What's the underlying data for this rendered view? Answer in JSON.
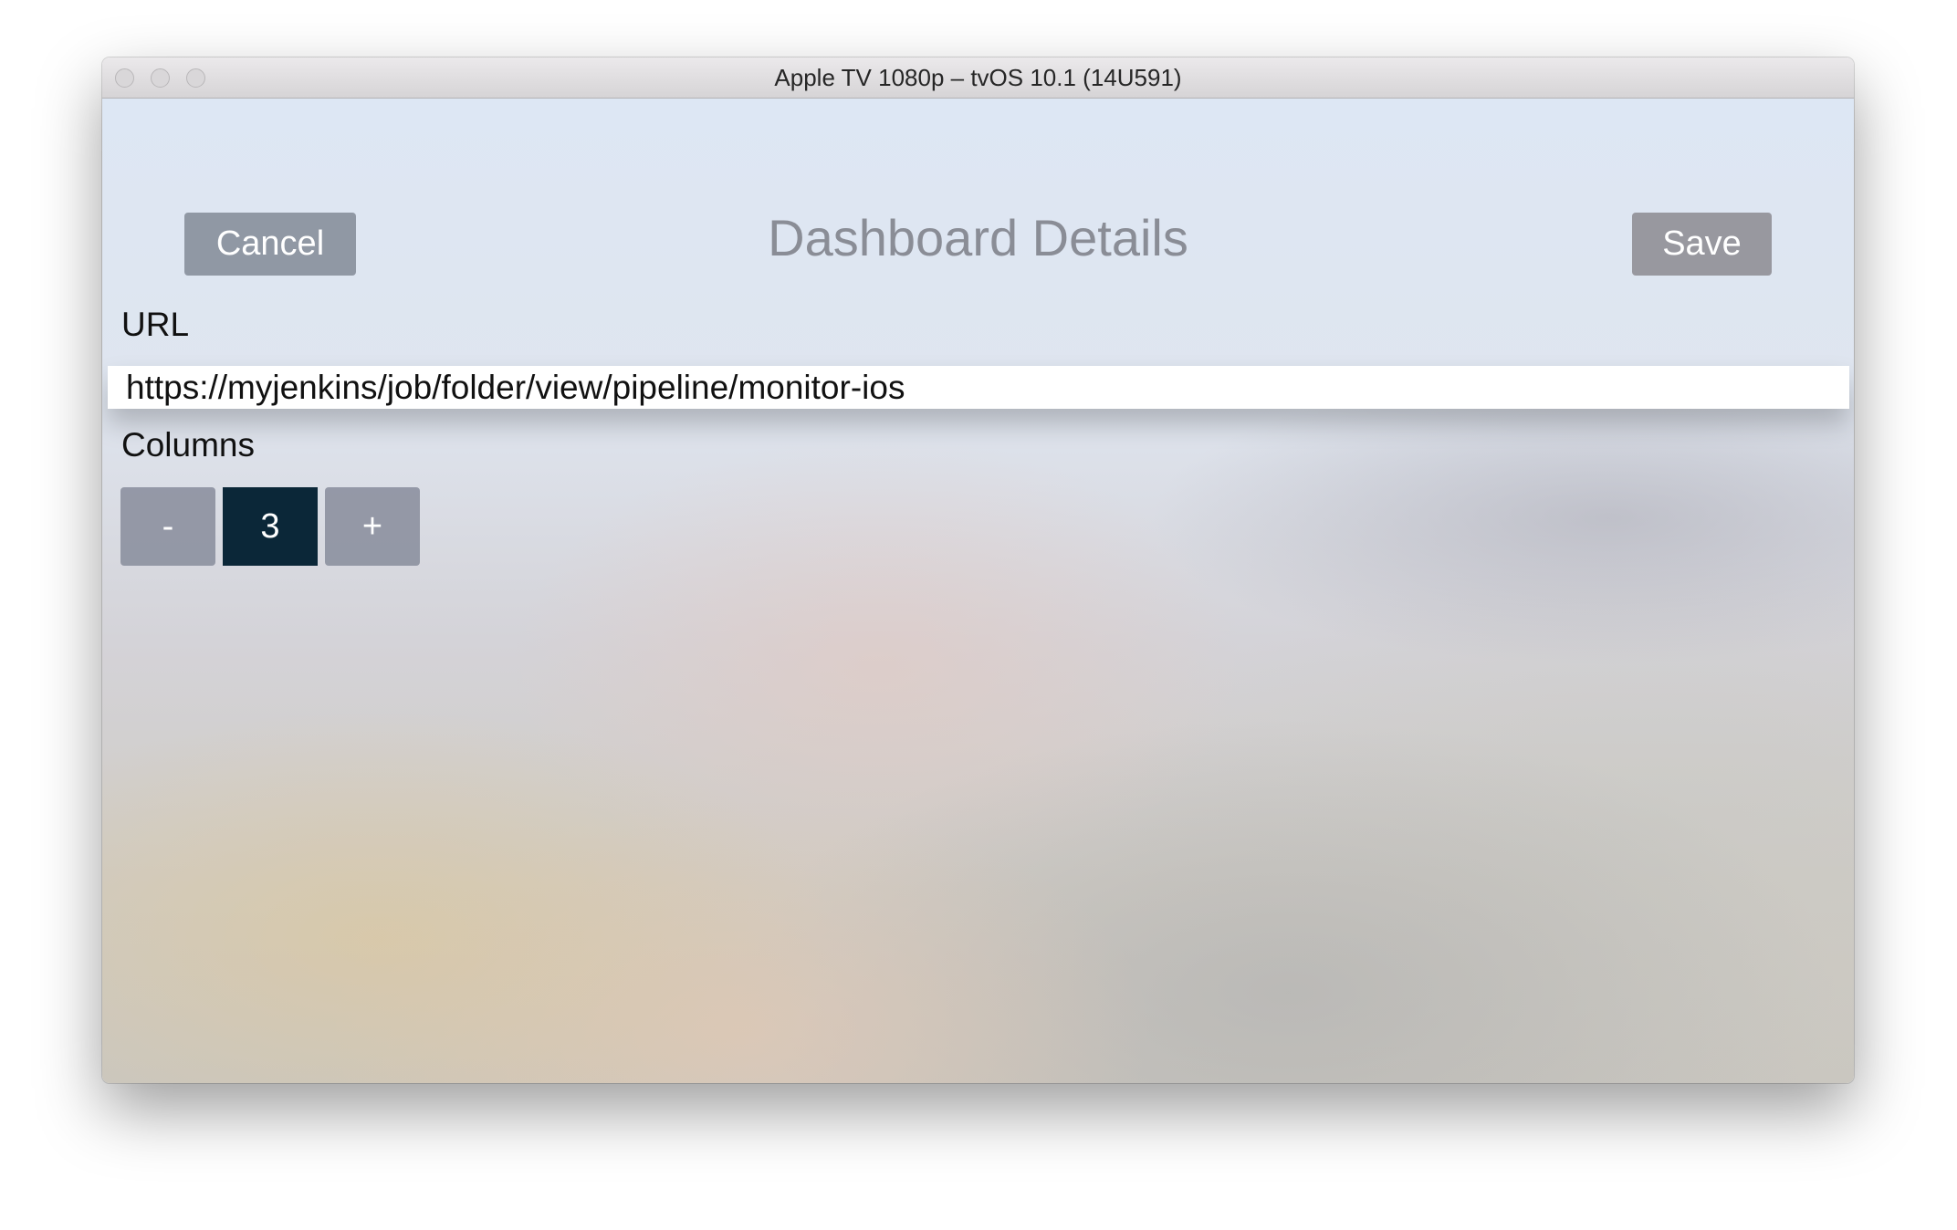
{
  "window": {
    "title": "Apple TV 1080p – tvOS 10.1 (14U591)"
  },
  "header": {
    "title": "Dashboard Details",
    "cancel_label": "Cancel",
    "save_label": "Save"
  },
  "form": {
    "url_label": "URL",
    "url_value": "https://myjenkins/job/folder/view/pipeline/monitor-ios",
    "columns_label": "Columns",
    "columns": {
      "decrement_label": "-",
      "value": "3",
      "increment_label": "+"
    }
  }
}
